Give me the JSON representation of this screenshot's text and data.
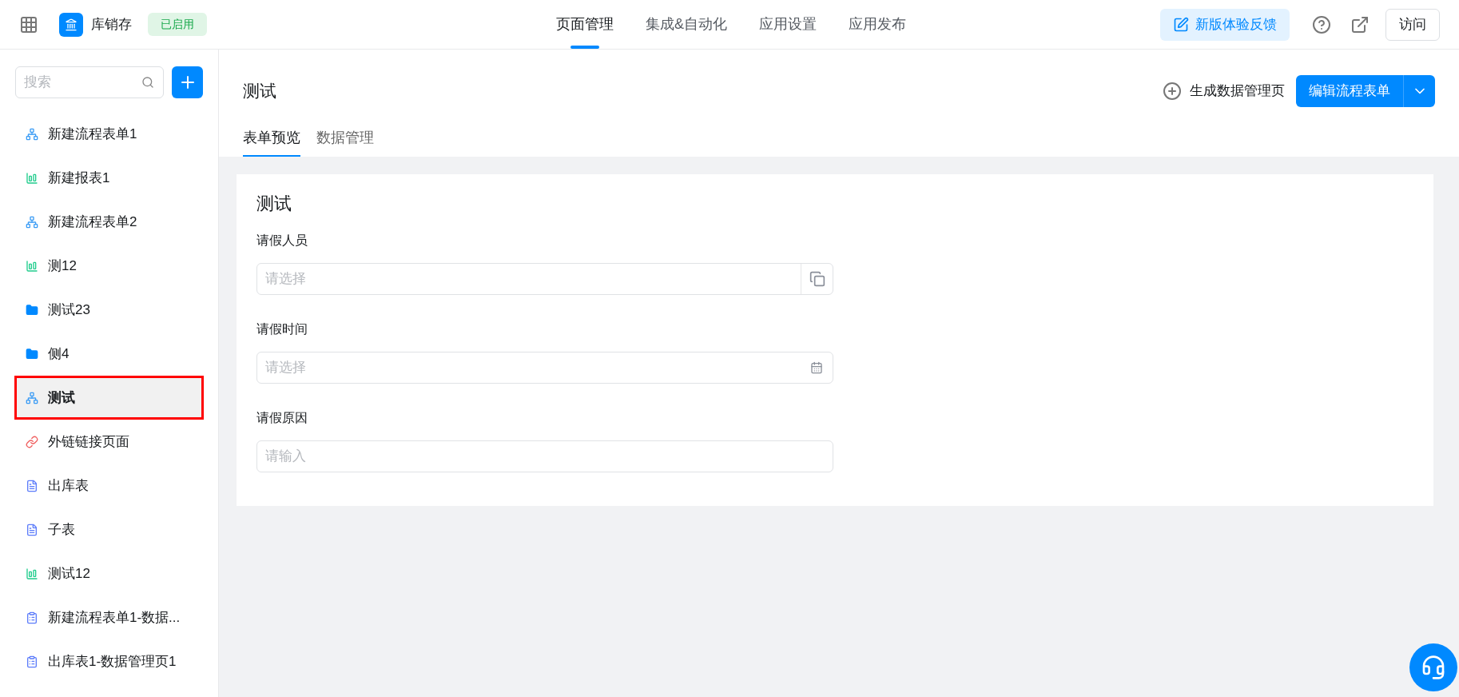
{
  "header": {
    "app_name": "库销存",
    "status_badge": "已启用",
    "nav": [
      {
        "label": "页面管理",
        "selected": true
      },
      {
        "label": "集成&自动化",
        "selected": false
      },
      {
        "label": "应用设置",
        "selected": false
      },
      {
        "label": "应用发布",
        "selected": false
      }
    ],
    "feedback_button": "新版体验反馈",
    "visit_button": "访问"
  },
  "sidebar": {
    "search": {
      "placeholder": "搜索"
    },
    "items": [
      {
        "label": "新建流程表单1",
        "kind": "flow",
        "selected": false
      },
      {
        "label": "新建报表1",
        "kind": "report",
        "selected": false
      },
      {
        "label": "新建流程表单2",
        "kind": "flow",
        "selected": false
      },
      {
        "label": "测12",
        "kind": "report",
        "selected": false
      },
      {
        "label": "测试23",
        "kind": "folder",
        "selected": false
      },
      {
        "label": "侧4",
        "kind": "folder",
        "selected": false
      },
      {
        "label": "测试",
        "kind": "flow",
        "selected": true
      },
      {
        "label": "外链链接页面",
        "kind": "link",
        "selected": false
      },
      {
        "label": "出库表",
        "kind": "form",
        "selected": false
      },
      {
        "label": "子表",
        "kind": "form",
        "selected": false
      },
      {
        "label": "测试12",
        "kind": "report",
        "selected": false
      },
      {
        "label": "新建流程表单1-数据...",
        "kind": "datamgr",
        "selected": false
      },
      {
        "label": "出库表1-数据管理页1",
        "kind": "datamgr",
        "selected": false
      }
    ]
  },
  "page": {
    "title": "测试",
    "generate_button": "生成数据管理页",
    "edit_button": "编辑流程表单",
    "tabs": [
      {
        "label": "表单预览",
        "selected": true
      },
      {
        "label": "数据管理",
        "selected": false
      }
    ]
  },
  "form": {
    "title": "测试",
    "fields": [
      {
        "label": "请假人员",
        "placeholder": "请选择",
        "kind": "member"
      },
      {
        "label": "请假时间",
        "placeholder": "请选择",
        "kind": "date"
      },
      {
        "label": "请假原因",
        "placeholder": "请输入",
        "kind": "text"
      }
    ]
  }
}
